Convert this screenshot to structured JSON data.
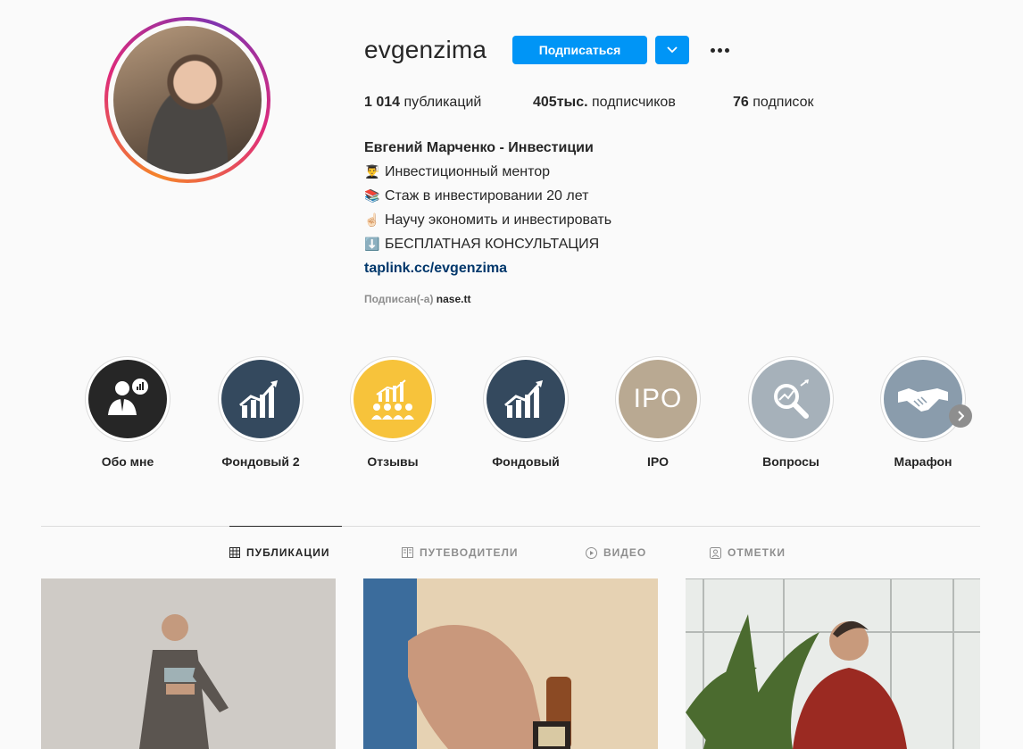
{
  "profile": {
    "username": "evgenzima",
    "follow_label": "Подписаться",
    "stats": {
      "posts_count": "1 014",
      "posts_label": "публикаций",
      "followers_count": "405тыс.",
      "followers_label": "подписчиков",
      "following_count": "76",
      "following_label": "подписок"
    },
    "full_name": "Евгений Марченко - Инвестиции",
    "bio_lines": [
      {
        "emoji": "👨‍🎓",
        "text": "Инвестиционный ментор"
      },
      {
        "emoji": "📚",
        "text": "Стаж в инвестировании 20 лет"
      },
      {
        "emoji": "☝🏻",
        "text": "Научу экономить и инвестировать"
      },
      {
        "emoji": "⬇️",
        "text": "БЕСПЛАТНАЯ КОНСУЛЬТАЦИЯ"
      }
    ],
    "link": "taplink.cc/evgenzima",
    "followed_by_label": "Подписан(-а)",
    "followed_by_user": "nase.tt"
  },
  "highlights": [
    {
      "label": "Обо мне",
      "color": "#262626"
    },
    {
      "label": "Фондовый 2",
      "color": "#34495e"
    },
    {
      "label": "Отзывы",
      "color": "#f7c33b"
    },
    {
      "label": "Фондовый",
      "color": "#34495e"
    },
    {
      "label": "IPO",
      "color": "#b9a992",
      "text": "IPO"
    },
    {
      "label": "Вопросы",
      "color": "#a6b1ba"
    },
    {
      "label": "Марафон",
      "color": "#8a9cac"
    }
  ],
  "tabs": [
    {
      "label": "ПУБЛИКАЦИИ",
      "icon": "grid-icon",
      "active": true
    },
    {
      "label": "ПУТЕВОДИТЕЛИ",
      "icon": "guide-icon",
      "active": false
    },
    {
      "label": "ВИДЕО",
      "icon": "play-icon",
      "active": false
    },
    {
      "label": "ОТМЕТКИ",
      "icon": "tag-icon",
      "active": false
    }
  ],
  "colors": {
    "accent": "#0095f6",
    "link": "#00376b",
    "muted": "#8e8e8e"
  }
}
